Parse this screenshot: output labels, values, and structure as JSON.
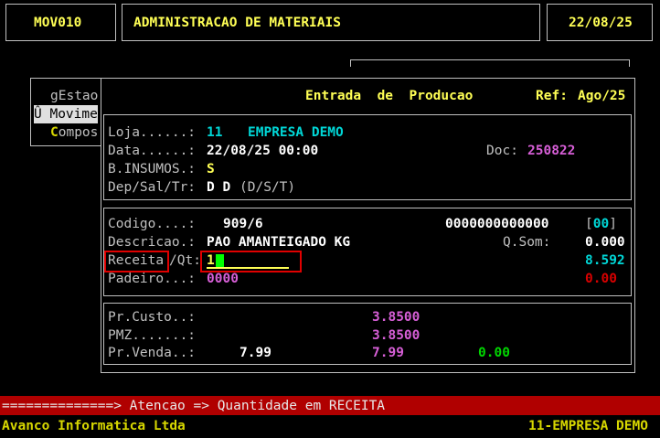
{
  "header": {
    "program_code": "MOV010",
    "system_title": "ADMINISTRACAO DE MATERIAIS",
    "date": "22/08/25"
  },
  "menu": {
    "items": [
      {
        "label": "gEstao"
      },
      {
        "label": "Û Movime"
      },
      {
        "hotkey": "C",
        "rest": "ompos"
      }
    ]
  },
  "form": {
    "title": "Entrada  de  Producao",
    "ref_label": "Ref:",
    "ref_value": "Ago/25",
    "loja_label": "Loja......:",
    "loja_code": "11",
    "loja_name": "EMPRESA DEMO",
    "data_label": "Data......:",
    "data_value": "22/08/25 00:00",
    "doc_label": "Doc:",
    "doc_value": "250822",
    "binsumos_label": "B.INSUMOS.:",
    "binsumos_value": "S",
    "dep_label": "Dep/Sal/Tr:",
    "dep_value": "D D",
    "dep_hint": "(D/S/T)",
    "codigo_label": "Codigo....:",
    "codigo_value": "909/6",
    "codigo_barcode": "0000000000000",
    "codigo_bracket_open": "[",
    "codigo_bracket_value": "00",
    "codigo_bracket_close": "]",
    "descricao_label": "Descricao.:",
    "descricao_value": "PAO AMANTEIGADO KG",
    "qsom_label": "Q.Som:",
    "qsom_value": "0.000",
    "receita_label": "Receita",
    "qt_label": "/Qt:",
    "receita_input_value": "1",
    "receita_right_value": "8.592",
    "padeiro_label": "Padeiro...:",
    "padeiro_value": "0000",
    "padeiro_right_value": "0.00",
    "prcusto_label": "Pr.Custo..:",
    "prcusto_value": "3.8500",
    "pmz_label": "PMZ.......:",
    "pmz_value": "3.8500",
    "prvenda_label": "Pr.Venda..:",
    "prvenda_value1": "7.99",
    "prvenda_value2": "7.99",
    "prvenda_value3": "0.00"
  },
  "status": {
    "message": "==============> Atencao => Quantidade em RECEITA",
    "company_left": "Avanco Informatica Ltda",
    "company_right": "11-EMPRESA DEMO"
  }
}
